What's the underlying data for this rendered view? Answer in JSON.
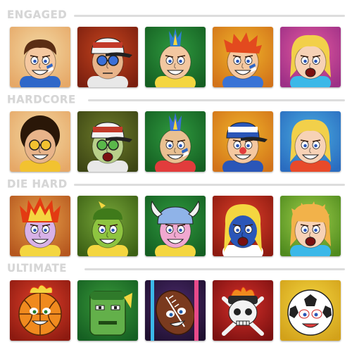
{
  "sections": [
    {
      "title": "ENGAGED",
      "tiles": [
        {
          "icon": "fan-face-painted-cheek-icon",
          "bg": [
            "#f3d9a4",
            "#e6a867"
          ],
          "skin": "#f5c8a0",
          "hair": "#5a2d14",
          "accent": "#2e67c9"
        },
        {
          "icon": "fan-trucker-cap-sunglasses-icon",
          "bg": [
            "#c8451e",
            "#7a1f0f"
          ],
          "skin": "#e8b48a",
          "hair": "#222222",
          "accent": "#e8e8e8"
        },
        {
          "icon": "fan-mohawk-grin-icon",
          "bg": [
            "#2f9a3f",
            "#155f22"
          ],
          "skin": "#f2c7a0",
          "hair": "#2d7fd1",
          "accent": "#f4d640"
        },
        {
          "icon": "fan-red-spiky-hair-icon",
          "bg": [
            "#f0b52a",
            "#d2731a"
          ],
          "skin": "#f5c8a0",
          "hair": "#e34a1e",
          "accent": "#3973d6"
        },
        {
          "icon": "fan-blonde-woman-icon",
          "bg": [
            "#e65aa0",
            "#9c2f86"
          ],
          "skin": "#f7d2b6",
          "hair": "#f2d04a",
          "accent": "#3bb8e8"
        }
      ]
    },
    {
      "title": "HARDCORE",
      "tiles": [
        {
          "icon": "fan-afro-goggles-icon",
          "bg": [
            "#f3d9a4",
            "#e6a867"
          ],
          "skin": "#e8b48a",
          "hair": "#2a1708",
          "accent": "#f2c230"
        },
        {
          "icon": "fan-visor-goggles-icon",
          "bg": [
            "#6f7d2a",
            "#3c4514"
          ],
          "skin": "#b9d08a",
          "hair": "#2a2a2a",
          "accent": "#e8e8e8"
        },
        {
          "icon": "fan-mohawk-face-paint-icon",
          "bg": [
            "#2f9a3f",
            "#155f22"
          ],
          "skin": "#e9c091",
          "hair": "#3a6fd8",
          "accent": "#e23c3c"
        },
        {
          "icon": "fan-clown-cap-icon",
          "bg": [
            "#f0b52a",
            "#d2731a"
          ],
          "skin": "#f5c8a0",
          "hair": "#e34a1e",
          "accent": "#2a56b8"
        },
        {
          "icon": "fan-blonde-wink-icon",
          "bg": [
            "#4aaee0",
            "#2a6cc0"
          ],
          "skin": "#f7d2b6",
          "hair": "#f2d04a",
          "accent": "#e84a2a"
        }
      ]
    },
    {
      "title": "DIE HARD",
      "tiles": [
        {
          "icon": "fan-flaming-hair-icon",
          "bg": [
            "#e8a24a",
            "#b5561e"
          ],
          "skin": "#d8b2e8",
          "hair": "#e33a12",
          "accent": "#f4d640"
        },
        {
          "icon": "fan-green-monster-icon",
          "bg": [
            "#79a83a",
            "#3c6014"
          ],
          "skin": "#8ec440",
          "hair": "#3f7a1a",
          "accent": "#f4d640"
        },
        {
          "icon": "fan-viking-helmet-icon",
          "bg": [
            "#2f9a3f",
            "#155f22"
          ],
          "skin": "#f0a8d0",
          "hair": "#8fb3e8",
          "accent": "#f4d640"
        },
        {
          "icon": "fan-screaming-blue-face-icon",
          "bg": [
            "#e0402a",
            "#8c1a10"
          ],
          "skin": "#2a56b8",
          "hair": "#f4d640",
          "accent": "#ffffff"
        },
        {
          "icon": "fan-green-hair-screamer-icon",
          "bg": [
            "#9fd04a",
            "#4f8a1e"
          ],
          "skin": "#f7d2b6",
          "hair": "#f2b24a",
          "accent": "#3bb8e8"
        }
      ]
    },
    {
      "title": "ULTIMATE",
      "tiles": [
        {
          "icon": "basketball-face-icon",
          "bg": [
            "#e0402a",
            "#8c1a10"
          ],
          "skin": "#f08a1e",
          "hair": "#f4d640",
          "accent": "#222222"
        },
        {
          "icon": "green-block-head-icon",
          "bg": [
            "#3a9a3a",
            "#155f22"
          ],
          "skin": "#63b04a",
          "hair": "#2f7a2a",
          "accent": "#f4d640"
        },
        {
          "icon": "football-face-icon",
          "bg": [
            "#4a2a6a",
            "#1f1030"
          ],
          "skin": "#7a3a1e",
          "hair": "#e84a8a",
          "accent": "#ffffff"
        },
        {
          "icon": "skull-bats-icon",
          "bg": [
            "#d8302a",
            "#7a1010"
          ],
          "skin": "#f2f2f2",
          "hair": "#f08a1e",
          "accent": "#222222"
        },
        {
          "icon": "soccer-ball-face-icon",
          "bg": [
            "#f4d640",
            "#d2a11a"
          ],
          "skin": "#ffffff",
          "hair": "#222222",
          "accent": "#e23c3c"
        }
      ]
    }
  ]
}
